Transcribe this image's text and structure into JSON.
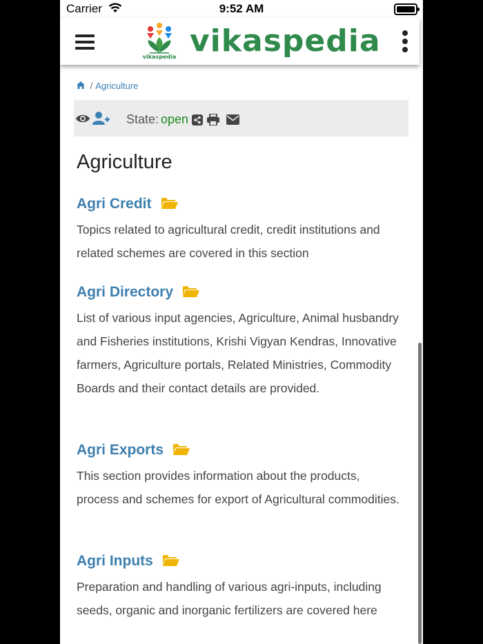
{
  "status_bar": {
    "carrier": "Carrier",
    "time": "9:52 AM"
  },
  "header": {
    "logo_text": "vikaspedia",
    "logo_subtext": "vikaspedia"
  },
  "breadcrumb": {
    "separator": "/",
    "current": "Agriculture"
  },
  "toolbar": {
    "state_label": "State:",
    "state_value": "open"
  },
  "page": {
    "title": "Agriculture"
  },
  "sections": [
    {
      "title": "Agri Credit",
      "description": "Topics related to agricultural credit, credit institutions and related schemes are covered in this section"
    },
    {
      "title": "Agri Directory",
      "description": "List of various input agencies, Agriculture, Animal husbandry and Fisheries institutions, Krishi Vigyan Kendras, Innovative farmers, Agriculture portals, Related Ministries, Commodity Boards and their contact details are provided."
    },
    {
      "title": "Agri Exports",
      "description": "This section provides information about the products, process and schemes for export of Agricultural commodities."
    },
    {
      "title": "Agri Inputs",
      "description": "Preparation and handling of various agri-inputs, including seeds, organic and inorganic fertilizers are covered here"
    }
  ],
  "colors": {
    "link": "#3d7fae",
    "state_open": "#1e8a1e",
    "folder": "#f0b400",
    "logo": "#2f8a4c"
  },
  "icons": [
    "wifi-icon",
    "battery-icon",
    "hamburger-icon",
    "kebab-menu-icon",
    "home-icon",
    "eye-icon",
    "add-user-icon",
    "share-icon",
    "print-icon",
    "email-icon",
    "folder-open-icon"
  ]
}
